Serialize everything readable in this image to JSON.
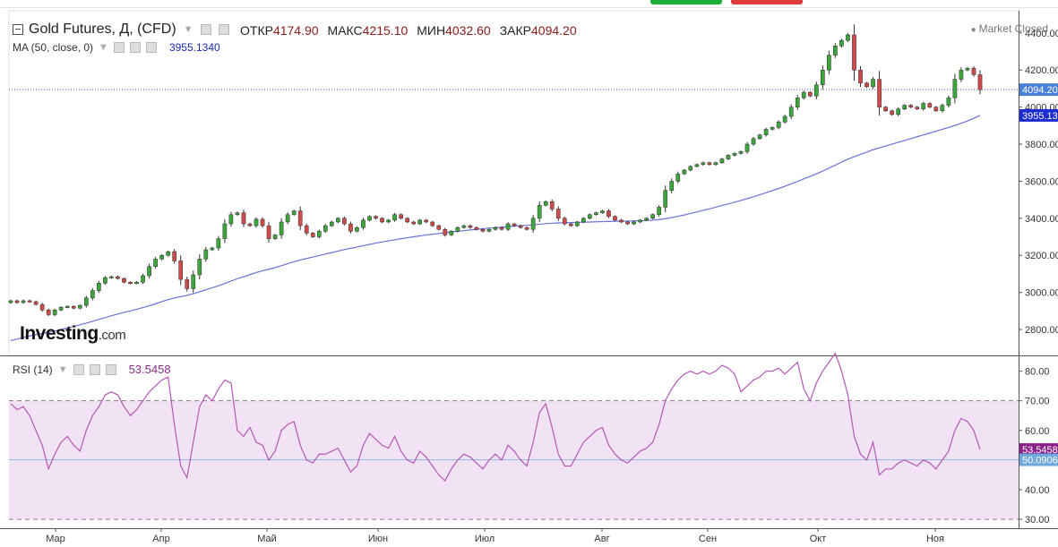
{
  "header": {
    "title": "Gold Futures, Д, (CFD)",
    "ohlc": [
      {
        "label": "ОТКР",
        "value": "4174.90"
      },
      {
        "label": "МАКС",
        "value": "4215.10"
      },
      {
        "label": "МИН",
        "value": "4032.60"
      },
      {
        "label": "ЗАКР",
        "value": "4094.20"
      }
    ],
    "market_status": "Market Closed"
  },
  "ma_indicator": {
    "label": "MA (50, close, 0)",
    "value": "3955.1340"
  },
  "rsi_indicator": {
    "label": "RSI (14)",
    "value": "53.5458"
  },
  "logo": {
    "main": "Investing",
    "suffix": ".com"
  },
  "colors": {
    "up": "#3ca53c",
    "down": "#cf4b4b",
    "ma_line": "#6b72d8",
    "rsi_line": "#b458b4",
    "rsi_band": "#f1e3f3",
    "price_tag_bg": "#4a7fd6",
    "ma_tag_bg": "#1c2bcf",
    "rsi_tag_bg": "#8a1f8a",
    "rsi_mid_tag_bg": "#6fa8dc",
    "top_button_green": "#1db13b",
    "top_button_red": "#e13d3d"
  },
  "chart_data": {
    "type": "candlestick",
    "x_tick_labels": [
      "Мар",
      "Апр",
      "Май",
      "Июн",
      "Июл",
      "Авг",
      "Сен",
      "Окт",
      "Ноя"
    ],
    "price_axis": {
      "ylim": [
        2660,
        4520
      ],
      "ticks": [
        "2800.00",
        "3000.00",
        "3200.00",
        "3400.00",
        "3600.00",
        "3800.00",
        "4000.00",
        "4200.00",
        "4400.00"
      ],
      "last_price": "4094.20",
      "ma_value": "3955.13"
    },
    "rsi_axis": {
      "ylim": [
        27,
        85
      ],
      "ticks": [
        "30.00",
        "40.00",
        "50.00",
        "60.00",
        "70.00",
        "80.00"
      ],
      "overbought": 70,
      "oversold": 30,
      "current": "53.5458",
      "mid_value": "50.0906",
      "mid_level": 50.09
    },
    "closes": [
      2955,
      2945,
      2955,
      2950,
      2935,
      2905,
      2880,
      2905,
      2920,
      2925,
      2915,
      2930,
      2970,
      3010,
      3050,
      3080,
      3085,
      3075,
      3055,
      3050,
      3055,
      3090,
      3140,
      3180,
      3200,
      3220,
      3170,
      3070,
      3020,
      3095,
      3180,
      3230,
      3240,
      3290,
      3370,
      3420,
      3430,
      3370,
      3360,
      3395,
      3360,
      3290,
      3310,
      3380,
      3420,
      3440,
      3360,
      3320,
      3300,
      3330,
      3360,
      3380,
      3400,
      3370,
      3330,
      3350,
      3390,
      3410,
      3400,
      3380,
      3390,
      3420,
      3400,
      3380,
      3370,
      3390,
      3380,
      3360,
      3340,
      3310,
      3330,
      3350,
      3360,
      3350,
      3340,
      3330,
      3340,
      3350,
      3340,
      3370,
      3360,
      3350,
      3340,
      3400,
      3470,
      3490,
      3450,
      3400,
      3370,
      3360,
      3380,
      3400,
      3420,
      3430,
      3440,
      3410,
      3390,
      3380,
      3370,
      3380,
      3390,
      3400,
      3420,
      3460,
      3550,
      3600,
      3640,
      3660,
      3680,
      3690,
      3700,
      3690,
      3700,
      3720,
      3740,
      3750,
      3760,
      3800,
      3830,
      3850,
      3880,
      3890,
      3920,
      3950,
      4000,
      4050,
      4080,
      4060,
      4120,
      4200,
      4280,
      4330,
      4360,
      4390,
      4200,
      4130,
      4110,
      4150,
      4000,
      3980,
      3960,
      3990,
      4010,
      4000,
      3990,
      4020,
      4000,
      3980,
      4010,
      4050,
      4150,
      4200,
      4210,
      4175,
      4094
    ],
    "ma50": [
      2740,
      2748,
      2757,
      2765,
      2772,
      2779,
      2785,
      2792,
      2800,
      2808,
      2816,
      2825,
      2834,
      2844,
      2854,
      2864,
      2874,
      2883,
      2892,
      2900,
      2909,
      2918,
      2928,
      2939,
      2950,
      2961,
      2970,
      2977,
      2984,
      2993,
      3003,
      3014,
      3025,
      3036,
      3048,
      3061,
      3074,
      3085,
      3096,
      3107,
      3117,
      3125,
      3134,
      3144,
      3155,
      3166,
      3175,
      3183,
      3191,
      3199,
      3207,
      3215,
      3223,
      3231,
      3238,
      3245,
      3252,
      3259,
      3266,
      3272,
      3278,
      3284,
      3290,
      3295,
      3300,
      3305,
      3310,
      3314,
      3318,
      3322,
      3326,
      3330,
      3333,
      3337,
      3340,
      3344,
      3347,
      3350,
      3352,
      3355,
      3358,
      3360,
      3362,
      3365,
      3368,
      3371,
      3373,
      3375,
      3376,
      3377,
      3378,
      3379,
      3380,
      3381,
      3382,
      3383,
      3384,
      3384,
      3385,
      3386,
      3387,
      3388,
      3390,
      3393,
      3398,
      3404,
      3411,
      3418,
      3426,
      3434,
      3443,
      3451,
      3460,
      3469,
      3478,
      3487,
      3496,
      3506,
      3516,
      3527,
      3538,
      3549,
      3561,
      3573,
      3586,
      3599,
      3613,
      3626,
      3640,
      3655,
      3671,
      3687,
      3703,
      3719,
      3732,
      3745,
      3757,
      3770,
      3780,
      3790,
      3800,
      3810,
      3820,
      3830,
      3840,
      3850,
      3860,
      3870,
      3880,
      3890,
      3901,
      3913,
      3925,
      3940,
      3955
    ],
    "rsi": [
      69,
      67,
      68,
      65,
      60,
      55,
      47,
      52,
      56,
      58,
      55,
      53,
      60,
      65,
      68,
      72,
      73,
      72,
      68,
      65,
      67,
      70,
      73,
      75,
      77,
      78,
      62,
      48,
      44,
      56,
      68,
      72,
      70,
      74,
      77,
      76,
      60,
      58,
      61,
      56,
      55,
      50,
      53,
      60,
      62,
      63,
      55,
      50,
      49,
      52,
      52,
      53,
      54,
      50,
      46,
      48,
      55,
      59,
      57,
      55,
      54,
      58,
      53,
      50,
      49,
      53,
      51,
      48,
      45,
      43,
      47,
      50,
      52,
      51,
      49,
      47,
      50,
      52,
      50,
      55,
      53,
      50,
      48,
      56,
      66,
      69,
      61,
      52,
      48,
      48,
      52,
      56,
      58,
      60,
      61,
      55,
      52,
      50,
      49,
      51,
      53,
      54,
      56,
      62,
      70,
      74,
      77,
      79,
      80,
      79,
      80,
      79,
      80,
      82,
      81,
      79,
      73,
      75,
      77,
      78,
      80,
      80,
      81,
      79,
      81,
      83,
      74,
      70,
      76,
      80,
      83,
      86,
      80,
      72,
      58,
      52,
      50,
      56,
      45,
      47,
      47,
      49,
      50,
      49,
      48,
      50,
      49,
      47,
      50,
      53,
      60,
      64,
      63,
      60,
      53.55
    ],
    "opens_offset_note": ""
  }
}
